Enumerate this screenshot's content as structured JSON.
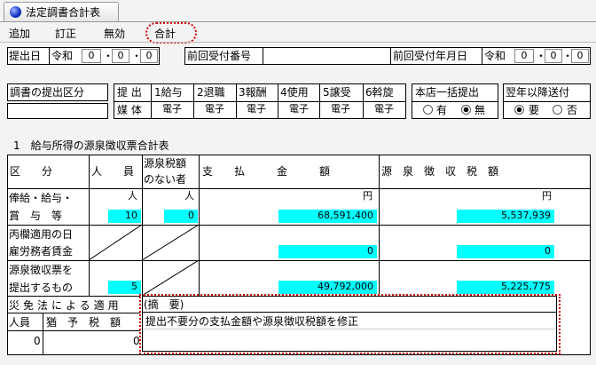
{
  "window": {
    "tab_title": "法定調書合計表"
  },
  "menu": [
    "追加",
    "訂正",
    "無効",
    "合計"
  ],
  "top": {
    "submit_date_label": "提出日",
    "era": "令和",
    "date": [
      "0",
      "0",
      "0"
    ],
    "prev_no_label": "前回受付番号",
    "prev_no": "",
    "prev_date_label": "前回受付年月日",
    "prev_era": "令和",
    "prev_date": [
      "0",
      "0",
      "0"
    ]
  },
  "teishutsu": {
    "label": "調書の提出区分",
    "teishutsu": "提 出",
    "baitai": "媒 体",
    "cols": [
      "1給与",
      "2退職",
      "3報酬",
      "4使用",
      "5譲受",
      "6斡旋"
    ],
    "values": [
      "電子",
      "電子",
      "電子",
      "電子",
      "電子",
      "電子"
    ],
    "ikkatsu_label": "本店一括提出",
    "ikkatsu_opts": [
      "有",
      "無"
    ],
    "yokunen_label": "翌年以降送付",
    "yokunen_opts": [
      "要",
      "否"
    ]
  },
  "section_title": "1　給与所得の源泉徴収票合計表",
  "table": {
    "headers": {
      "kubun": "区　　分",
      "jinin": "人　　員",
      "nashi1": "源泉税額",
      "nashi2": "のない者",
      "shiharai": "支　　払　　　金　　　額",
      "gensen": "源　泉　徴　収　税　額"
    },
    "units": {
      "nin": "人",
      "en": "円"
    },
    "rows": [
      {
        "label1": "俸給・給与・",
        "label2": "賞　与　等",
        "jinin": "10",
        "nashi": "0",
        "shiharai": "68,591,400",
        "gensen": "5,537,939"
      },
      {
        "label1": "丙欄適用の日",
        "label2": "雇労務者賃金",
        "jinin": "",
        "nashi": "",
        "shiharai": "0",
        "gensen": "0"
      },
      {
        "label1": "源泉徴収票を",
        "label2": "提出するもの",
        "jinin": "5",
        "nashi": "",
        "shiharai": "49,792,000",
        "gensen": "5,225,775"
      }
    ],
    "saimen": {
      "label": "災免法による適用",
      "jinin_label": "人員",
      "yuyo_label": "猶　予　税　額",
      "jinin": "0",
      "yuyo": "0"
    },
    "tekiyo": {
      "label": "(摘　要)",
      "text": "提出不要分の支払金額や源泉徴収税額を修正"
    }
  }
}
